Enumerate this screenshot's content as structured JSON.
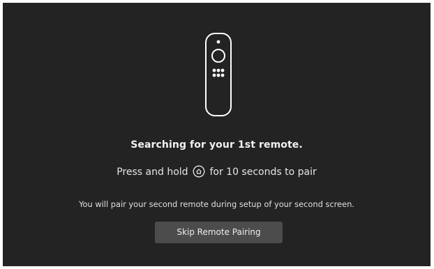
{
  "header": {
    "remote_icon": "fire-tv-remote-icon"
  },
  "main": {
    "title": "Searching for your 1st remote.",
    "instruction_before": "Press and hold",
    "instruction_icon": "home-button-icon",
    "instruction_after": "for 10 seconds to pair",
    "note": "You will pair your second remote during setup of your second screen."
  },
  "actions": {
    "skip_label": "Skip Remote Pairing"
  },
  "colors": {
    "background": "#232323",
    "button": "#4c4c4c",
    "text": "#ffffff"
  }
}
